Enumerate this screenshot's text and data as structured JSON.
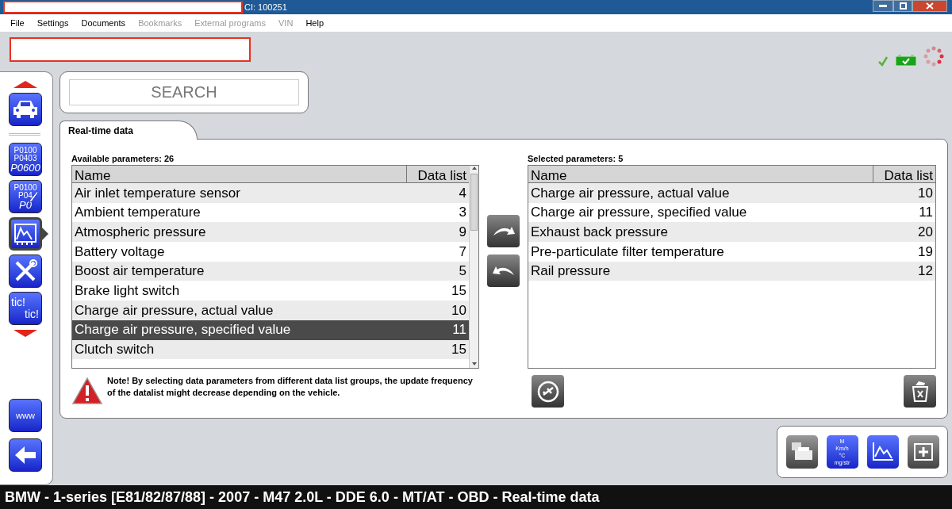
{
  "window": {
    "title": "CI: 100251"
  },
  "menu": [
    {
      "label": "File",
      "disabled": false
    },
    {
      "label": "Settings",
      "disabled": false
    },
    {
      "label": "Documents",
      "disabled": false
    },
    {
      "label": "Bookmarks",
      "disabled": true
    },
    {
      "label": "External programs",
      "disabled": true
    },
    {
      "label": "VIN",
      "disabled": true
    },
    {
      "label": "Help",
      "disabled": false
    }
  ],
  "sidebar": {
    "items": [
      {
        "kind": "car",
        "selected": false
      },
      {
        "kind": "codes",
        "selected": false,
        "lines": [
          "P0100",
          "P0403",
          "P0600"
        ]
      },
      {
        "kind": "codes-edit",
        "selected": false,
        "lines": [
          "P0100",
          "P04",
          "P0"
        ]
      },
      {
        "kind": "realtime",
        "selected": true
      },
      {
        "kind": "tools",
        "selected": false
      },
      {
        "kind": "tic",
        "selected": false,
        "lines": [
          "tic!",
          "tic!"
        ]
      }
    ],
    "bottom": [
      {
        "kind": "www",
        "label": "www"
      },
      {
        "kind": "back"
      }
    ]
  },
  "search": {
    "placeholder": "SEARCH"
  },
  "tabs": [
    {
      "label": "Real-time data",
      "selected": true
    }
  ],
  "available": {
    "title": "Available parameters: 26",
    "columns": [
      "Name",
      "Data list"
    ],
    "rows": [
      {
        "name": "Air inlet temperature sensor",
        "data_list": "4",
        "selected": false
      },
      {
        "name": "Ambient temperature",
        "data_list": "3",
        "selected": false
      },
      {
        "name": "Atmospheric pressure",
        "data_list": "9",
        "selected": false
      },
      {
        "name": "Battery voltage",
        "data_list": "7",
        "selected": false
      },
      {
        "name": "Boost air temperature",
        "data_list": "5",
        "selected": false
      },
      {
        "name": "Brake light switch",
        "data_list": "15",
        "selected": false
      },
      {
        "name": "Charge air pressure, actual value",
        "data_list": "10",
        "selected": false
      },
      {
        "name": "Charge air pressure, specified value",
        "data_list": "11",
        "selected": true
      },
      {
        "name": "Clutch switch",
        "data_list": "15",
        "selected": false
      }
    ]
  },
  "selected_params": {
    "title": "Selected parameters: 5",
    "columns": [
      "Name",
      "Data list"
    ],
    "rows": [
      {
        "name": "Charge air pressure, actual value",
        "data_list": "10",
        "selected": false
      },
      {
        "name": "Charge air pressure, specified value",
        "data_list": "11",
        "selected": false
      },
      {
        "name": "Exhaust back pressure",
        "data_list": "20",
        "selected": false
      },
      {
        "name": "Pre-particulate filter temperature",
        "data_list": "19",
        "selected": false
      },
      {
        "name": "Rail pressure",
        "data_list": "12",
        "selected": false
      }
    ]
  },
  "note": "**Note!**  By selecting data parameters from different data list groups, the update frequency of the datalist might decrease depending on the vehicle.",
  "toolbar": [
    {
      "kind": "print"
    },
    {
      "kind": "units",
      "lines": [
        "M",
        "Km/h",
        "°C",
        "mg/str"
      ]
    },
    {
      "kind": "graph"
    },
    {
      "kind": "ecu"
    }
  ],
  "status_bar": "BMW - 1-series [E81/82/87/88] - 2007 - M47 2.0L - DDE 6.0 - MT/AT - OBD - Real-time data"
}
